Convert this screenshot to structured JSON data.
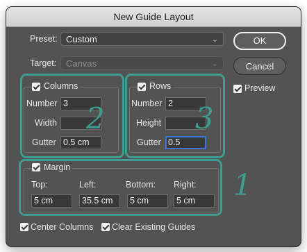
{
  "dialog": {
    "title": "New Guide Layout"
  },
  "preset": {
    "label": "Preset:",
    "value": "Custom"
  },
  "target": {
    "label": "Target:",
    "value": "Canvas"
  },
  "buttons": {
    "ok": "OK",
    "cancel": "Cancel"
  },
  "preview": {
    "label": "Preview",
    "checked": true
  },
  "columns": {
    "title": "Columns",
    "checked": true,
    "number_label": "Number",
    "number": "3",
    "width_label": "Width",
    "width": "",
    "gutter_label": "Gutter",
    "gutter": "0.5 cm"
  },
  "rows": {
    "title": "Rows",
    "checked": true,
    "number_label": "Number",
    "number": "2",
    "height_label": "Height",
    "height": "",
    "gutter_label": "Gutter",
    "gutter": "0.5"
  },
  "margin": {
    "title": "Margin",
    "checked": true,
    "top_label": "Top:",
    "top": "5 cm",
    "left_label": "Left:",
    "left": "35.5 cm",
    "bottom_label": "Bottom:",
    "bottom": "5 cm",
    "right_label": "Right:",
    "right": "5 cm"
  },
  "options": {
    "center_columns": "Center Columns",
    "clear_guides": "Clear Existing Guides"
  },
  "annotations": {
    "columns": "2",
    "rows": "3",
    "margin": "1"
  },
  "colors": {
    "dialog_bg": "#535353",
    "highlight": "#3f9c90",
    "focus": "#3a78d8"
  },
  "icons": {
    "dropdown": "chevron-down-icon",
    "check": "checkmark-icon"
  }
}
